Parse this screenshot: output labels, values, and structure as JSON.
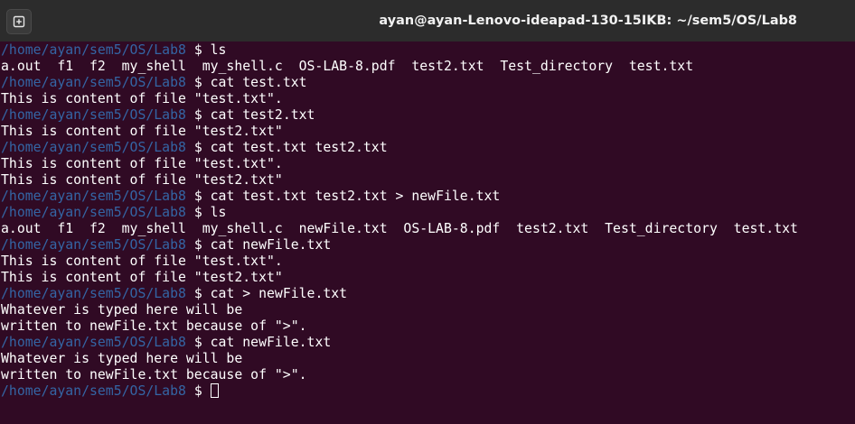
{
  "window": {
    "title": "ayan@ayan-Lenovo-ideapad-130-15IKB: ~/sem5/OS/Lab8"
  },
  "prompt": {
    "path": "/home/ayan/sem5/OS/Lab8",
    "symbol": " $ "
  },
  "terminal": {
    "lines": [
      {
        "kind": "prompt",
        "command": "ls"
      },
      {
        "kind": "output",
        "text": "a.out  f1  f2  my_shell  my_shell.c  OS-LAB-8.pdf  test2.txt  Test_directory  test.txt"
      },
      {
        "kind": "prompt",
        "command": "cat test.txt"
      },
      {
        "kind": "output",
        "text": "This is content of file \"test.txt\"."
      },
      {
        "kind": "prompt",
        "command": "cat test2.txt"
      },
      {
        "kind": "output",
        "text": "This is content of file \"test2.txt\""
      },
      {
        "kind": "prompt",
        "command": "cat test.txt test2.txt"
      },
      {
        "kind": "output",
        "text": "This is content of file \"test.txt\"."
      },
      {
        "kind": "output",
        "text": "This is content of file \"test2.txt\""
      },
      {
        "kind": "prompt",
        "command": "cat test.txt test2.txt > newFile.txt"
      },
      {
        "kind": "prompt",
        "command": "ls"
      },
      {
        "kind": "output",
        "text": "a.out  f1  f2  my_shell  my_shell.c  newFile.txt  OS-LAB-8.pdf  test2.txt  Test_directory  test.txt"
      },
      {
        "kind": "prompt",
        "command": "cat newFile.txt"
      },
      {
        "kind": "output",
        "text": "This is content of file \"test.txt\"."
      },
      {
        "kind": "output",
        "text": "This is content of file \"test2.txt\""
      },
      {
        "kind": "prompt",
        "command": "cat > newFile.txt"
      },
      {
        "kind": "output",
        "text": "Whatever is typed here will be"
      },
      {
        "kind": "output",
        "text": "written to newFile.txt because of \">\"."
      },
      {
        "kind": "prompt",
        "command": "cat newFile.txt"
      },
      {
        "kind": "output",
        "text": "Whatever is typed here will be"
      },
      {
        "kind": "output",
        "text": "written to newFile.txt because of \">\"."
      }
    ]
  },
  "colors": {
    "background": "#300a24",
    "titlebar": "#2c2c2c",
    "prompt_path": "#3465a4",
    "text": "#ffffff"
  },
  "icons": {
    "new_tab": "new-tab-icon"
  }
}
